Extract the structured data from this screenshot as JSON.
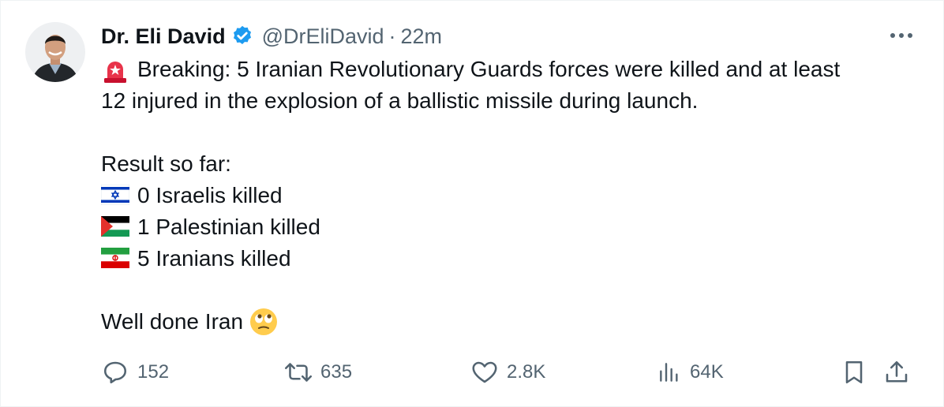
{
  "tweet": {
    "author": {
      "display_name": "Dr. Eli David",
      "handle": "@DrEliDavid",
      "separator": "·",
      "time": "22m"
    },
    "lines": [
      "Breaking: 5 Iranian Revolutionary Guards forces were killed and at least",
      "12 injured in the explosion of a ballistic missile during launch.",
      "Result so far:",
      "0 Israelis killed",
      "1 Palestinian killed",
      "5 Iranians killed",
      "Well done Iran"
    ],
    "emojis": [
      "rotating-light-icon",
      "israel-flag-icon",
      "palestine-flag-icon",
      "iran-flag-icon",
      "face-with-rolling-eyes-icon"
    ]
  },
  "actions": {
    "replies": "152",
    "reposts": "635",
    "likes": "2.8K",
    "views": "64K"
  },
  "colors": {
    "text": "#0f1419",
    "secondary": "#536471",
    "verified": "#1d9bf0"
  }
}
